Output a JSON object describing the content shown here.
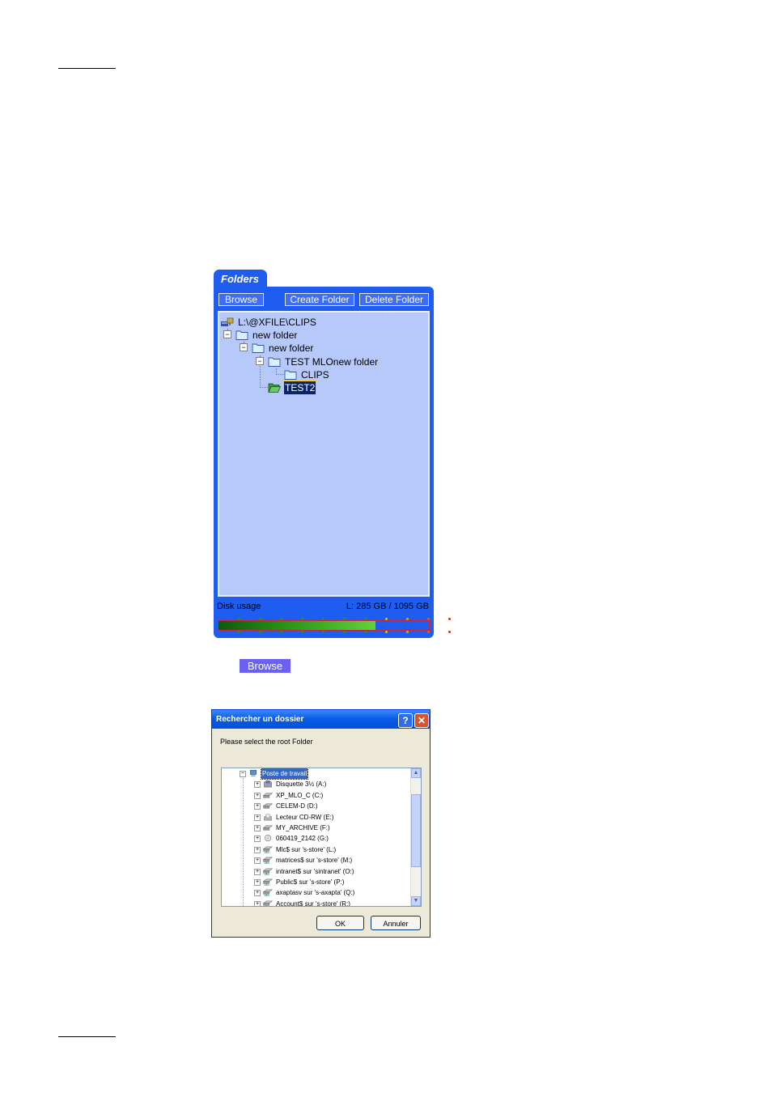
{
  "folders_panel": {
    "tab_label": "Folders",
    "browse_label": "Browse",
    "create_folder_label": "Create Folder",
    "delete_folder_label": "Delete Folder",
    "tree": {
      "root_path": "L:\\@XFILE\\CLIPS",
      "nodes": [
        {
          "label": "new folder",
          "expanded": true
        },
        {
          "label": "new folder",
          "expanded": true
        },
        {
          "label": "TEST MLOnew folder",
          "expanded": true
        },
        {
          "label": "CLIPS",
          "expanded": false
        },
        {
          "label": "TEST2",
          "expanded": false,
          "selected": true
        }
      ]
    },
    "disk_usage_label": "Disk usage",
    "disk_usage_value": "L: 285 GB / 1095 GB",
    "disk_usage_fraction": 0.745,
    "colors": {
      "panel": "#1f5cf0",
      "tree_bg": "#b6c9fa",
      "selection": "#0a246a"
    }
  },
  "browse_standalone_label": "Browse",
  "dialog": {
    "title": "Rechercher un dossier",
    "help_glyph": "?",
    "close_glyph": "✕",
    "prompt": "Please select the root Folder",
    "items": [
      {
        "label": "Poste de travail",
        "icon": "computer-icon",
        "selected": true
      },
      {
        "label": "Disquette 3½ (A:)",
        "icon": "floppy-drive-icon"
      },
      {
        "label": "XP_MLO_C (C:)",
        "icon": "hard-drive-icon"
      },
      {
        "label": "CELEM-D (D:)",
        "icon": "hard-drive-icon"
      },
      {
        "label": "Lecteur CD-RW (E:)",
        "icon": "cd-drive-icon"
      },
      {
        "label": "MY_ARCHIVE (F:)",
        "icon": "hard-drive-icon"
      },
      {
        "label": "060419_2142 (G:)",
        "icon": "cd-disc-icon"
      },
      {
        "label": "Mlc$ sur 's-store' (L:)",
        "icon": "network-drive-icon"
      },
      {
        "label": "matrices$ sur 's-store' (M:)",
        "icon": "network-drive-icon"
      },
      {
        "label": "intranet$ sur 'sintranet' (O:)",
        "icon": "network-drive-icon"
      },
      {
        "label": "Public$ sur 's-store' (P:)",
        "icon": "network-drive-icon"
      },
      {
        "label": "axaptasv sur 's-axapta' (Q:)",
        "icon": "network-drive-icon"
      },
      {
        "label": "Account$ sur 's-store' (R:)",
        "icon": "network-drive-icon"
      }
    ],
    "ok_label": "OK",
    "cancel_label": "Annuler"
  }
}
